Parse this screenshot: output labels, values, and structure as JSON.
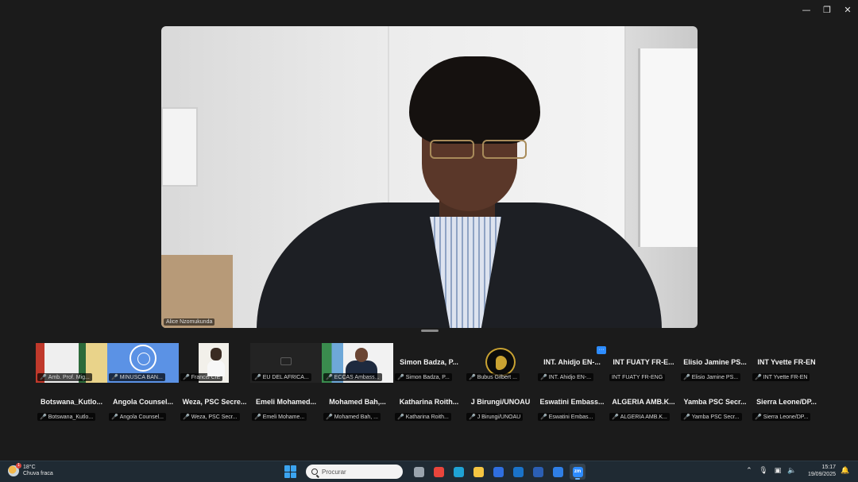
{
  "window": {
    "minimize": "—",
    "maximize": "❐",
    "close": "✕"
  },
  "main_speaker": {
    "name": "Alice Nzomukunda"
  },
  "gallery_row1": [
    {
      "label": "Amb. Prof. Mig...",
      "muted": true,
      "video": "video1"
    },
    {
      "label": "MINUSCA BAN...",
      "muted": true,
      "video": "video2"
    },
    {
      "label": "Francis CIE",
      "muted": true,
      "video": "video3"
    },
    {
      "label": "EU DEL AFRICA...",
      "muted": true,
      "video": "video4"
    },
    {
      "label": "ECCAS Ambass...",
      "muted": true,
      "video": "video5"
    },
    {
      "name": "Simon Badza, P...",
      "label": "Simon Badza, P...",
      "muted": true
    },
    {
      "label": "Bubus Gilbert ...",
      "muted": true,
      "video": "logo"
    },
    {
      "name": "INT. Ahidjo EN-...",
      "label": "INT. Ahidjo EN-...",
      "muted": true,
      "more": "···"
    },
    {
      "name": "INT FUATY FR-E...",
      "label": "INT FUATY FR-ENG",
      "muted": false
    },
    {
      "name": "Elisio Jamine PS...",
      "label": "Elisio Jamine PS...",
      "muted": true
    },
    {
      "name": "INT Yvette FR-EN",
      "label": "INT Yvette FR-EN",
      "muted": true
    }
  ],
  "gallery_row2": [
    {
      "name": "Botswana_Kutlo...",
      "label": "Botswana_Kutlo...",
      "muted": true
    },
    {
      "name": "Angola Counsel...",
      "label": "Angola Counsel...",
      "muted": true
    },
    {
      "name": "Weza, PSC Secre...",
      "label": "Weza, PSC Secr...",
      "muted": true
    },
    {
      "name": "Emeli Mohamed...",
      "label": "Emeli Mohame...",
      "muted": true
    },
    {
      "name": "Mohamed Bah,...",
      "label": "Mohamed Bah, ...",
      "muted": true
    },
    {
      "name": "Katharina Roith...",
      "label": "Katharina Roith...",
      "muted": true
    },
    {
      "name": "J Birungi/UNOAU",
      "label": "J Birungi/UNOAU",
      "muted": true
    },
    {
      "name": "Eswatini Embass...",
      "label": "Eswatini Embas...",
      "muted": true
    },
    {
      "name": "ALGERIA AMB.K...",
      "label": "ALGERIA AMB.K...",
      "muted": true
    },
    {
      "name": "Yamba PSC Secr...",
      "label": "Yamba PSC Secr...",
      "muted": true
    },
    {
      "name": "Sierra Leone/DP...",
      "label": "Sierra Leone/DP...",
      "muted": true
    }
  ],
  "taskbar": {
    "weather_temp": "18°C",
    "weather_desc": "Chuva fraca",
    "weather_badge": "1",
    "search_placeholder": "Procurar",
    "apps": [
      {
        "name": "task-view-icon",
        "color": "#9aa4ad"
      },
      {
        "name": "chrome-icon",
        "color": "#e8453c"
      },
      {
        "name": "edge-icon",
        "color": "#1fa3d6"
      },
      {
        "name": "file-explorer-icon",
        "color": "#f4c542"
      },
      {
        "name": "app-store-icon",
        "color": "#2f6fe0"
      },
      {
        "name": "outlook-icon",
        "color": "#1a73c9"
      },
      {
        "name": "word-icon",
        "color": "#2b5fb4"
      },
      {
        "name": "dropbox-icon",
        "color": "#2f7fe6"
      },
      {
        "name": "zoom-icon",
        "color": "#2d8cff",
        "text": "zm",
        "active": true
      }
    ],
    "time": "15:17",
    "date": "19/09/2025"
  }
}
